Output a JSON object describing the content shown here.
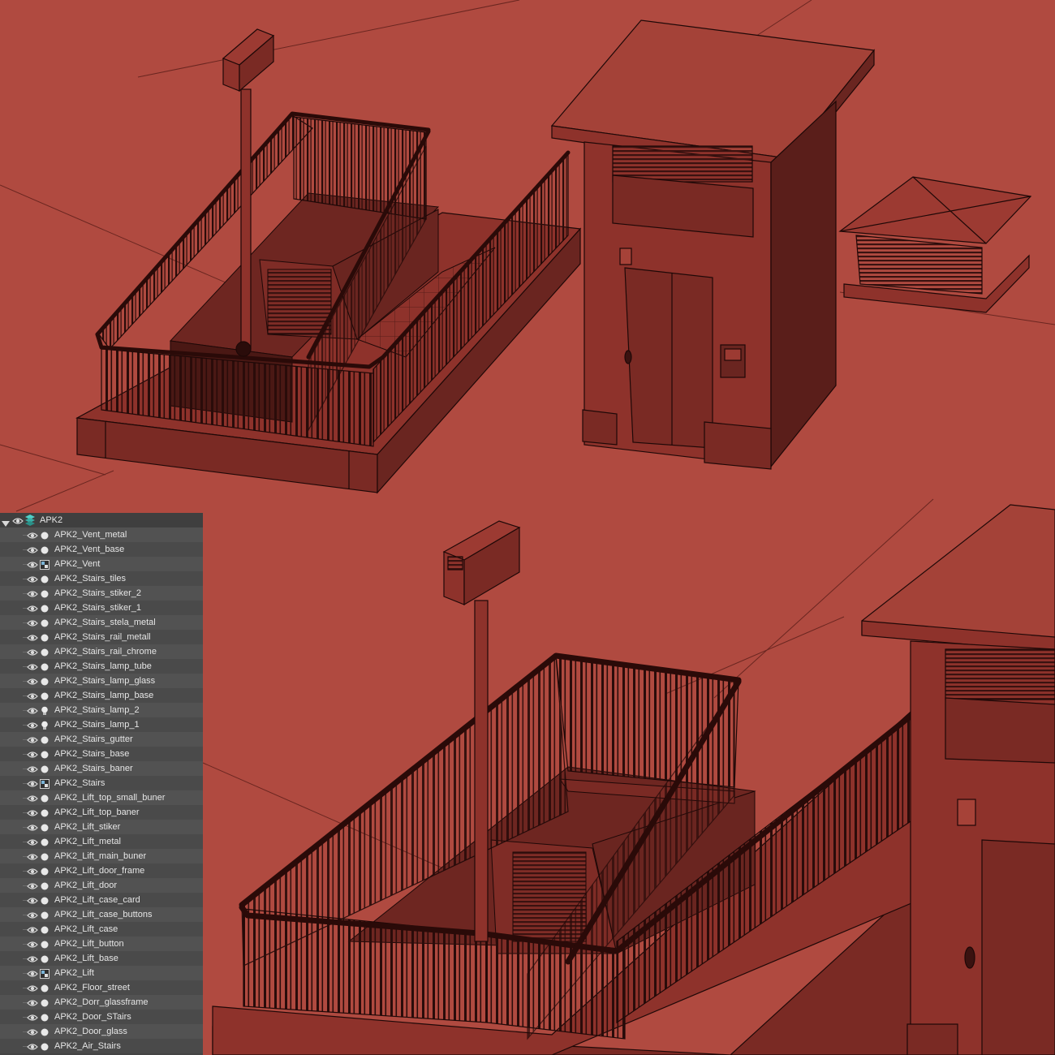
{
  "outliner": {
    "root": {
      "label": "APK2",
      "expanded": true,
      "icon": "layer-stack-icon",
      "visibility_icon": "eye-icon"
    },
    "items": [
      {
        "label": "APK2_Vent_metal",
        "icon": "sphere-icon"
      },
      {
        "label": "APK2_Vent_base",
        "icon": "sphere-icon"
      },
      {
        "label": "APK2_Vent",
        "icon": "group-icon"
      },
      {
        "label": "APK2_Stairs_tiles",
        "icon": "sphere-icon"
      },
      {
        "label": "APK2_Stairs_stiker_2",
        "icon": "sphere-icon"
      },
      {
        "label": "APK2_Stairs_stiker_1",
        "icon": "sphere-icon"
      },
      {
        "label": "APK2_Stairs_stela_metal",
        "icon": "sphere-icon"
      },
      {
        "label": "APK2_Stairs_rail_metall",
        "icon": "sphere-icon"
      },
      {
        "label": "APK2_Stairs_rail_chrome",
        "icon": "sphere-icon"
      },
      {
        "label": "APK2_Stairs_lamp_tube",
        "icon": "sphere-icon"
      },
      {
        "label": "APK2_Stairs_lamp_glass",
        "icon": "sphere-icon"
      },
      {
        "label": "APK2_Stairs_lamp_base",
        "icon": "sphere-icon"
      },
      {
        "label": "APK2_Stairs_lamp_2",
        "icon": "light-bulb-icon"
      },
      {
        "label": "APK2_Stairs_lamp_1",
        "icon": "light-bulb-icon"
      },
      {
        "label": "APK2_Stairs_gutter",
        "icon": "sphere-icon"
      },
      {
        "label": "APK2_Stairs_base",
        "icon": "sphere-icon"
      },
      {
        "label": "APK2_Stairs_baner",
        "icon": "sphere-icon"
      },
      {
        "label": "APK2_Stairs",
        "icon": "group-icon"
      },
      {
        "label": "APK2_Lift_top_small_buner",
        "icon": "sphere-icon"
      },
      {
        "label": "APK2_Lift_top_baner",
        "icon": "sphere-icon"
      },
      {
        "label": "APK2_Lift_stiker",
        "icon": "sphere-icon"
      },
      {
        "label": "APK2_Lift_metal",
        "icon": "sphere-icon"
      },
      {
        "label": "APK2_Lift_main_buner",
        "icon": "sphere-icon"
      },
      {
        "label": "APK2_Lift_door_frame",
        "icon": "sphere-icon"
      },
      {
        "label": "APK2_Lift_door",
        "icon": "sphere-icon"
      },
      {
        "label": "APK2_Lift_case_card",
        "icon": "sphere-icon"
      },
      {
        "label": "APK2_Lift_case_buttons",
        "icon": "sphere-icon"
      },
      {
        "label": "APK2_Lift_case",
        "icon": "sphere-icon"
      },
      {
        "label": "APK2_Lift_button",
        "icon": "sphere-icon"
      },
      {
        "label": "APK2_Lift_base",
        "icon": "sphere-icon"
      },
      {
        "label": "APK2_Lift",
        "icon": "group-icon"
      },
      {
        "label": "APK2_Floor_street",
        "icon": "sphere-icon"
      },
      {
        "label": "APK2_Dorr_glassframe",
        "icon": "sphere-icon"
      },
      {
        "label": "APK2_Door_STairs",
        "icon": "sphere-icon"
      },
      {
        "label": "APK2_Door_glass",
        "icon": "sphere-icon"
      },
      {
        "label": "APK2_Air_Stairs",
        "icon": "sphere-icon"
      }
    ]
  },
  "colors": {
    "viewport_background": "#b04a40",
    "model_face": "#8e322b",
    "model_shadow": "#5a1e1a",
    "edge_lines": "#1e0807",
    "panel_background": "#444444",
    "panel_text": "#e6e6e6"
  }
}
